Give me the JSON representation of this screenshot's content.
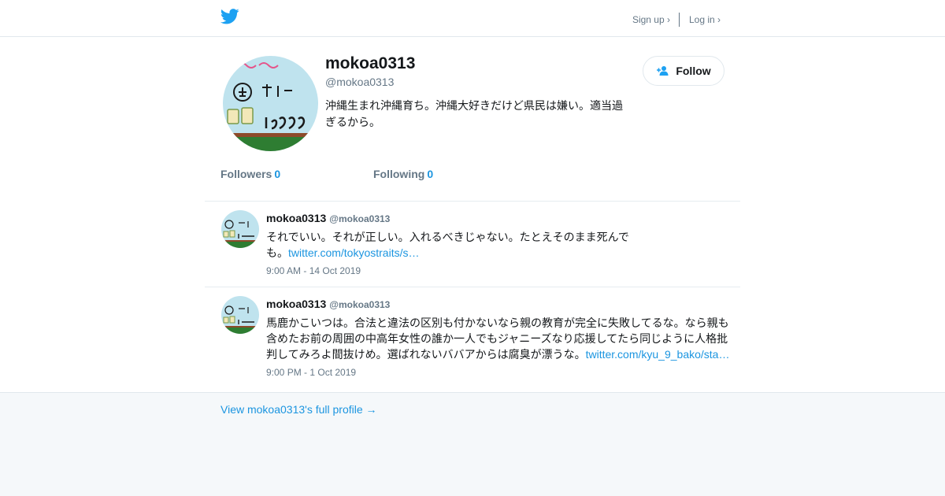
{
  "header": {
    "logo_icon": "twitter-bird-icon",
    "signup_label": "Sign up ›",
    "login_label": "Log in ›"
  },
  "profile": {
    "name": "mokoa0313",
    "handle": "@mokoa0313",
    "bio": "沖縄生まれ沖縄育ち。沖縄大好きだけど県民は嫌い。適当過ぎるから。",
    "follow_label": "Follow",
    "follow_icon": "add-person-icon",
    "followers_label": "Followers",
    "followers_count": "0",
    "following_label": "Following",
    "following_count": "0"
  },
  "tweets": [
    {
      "name": "mokoa0313",
      "handle": "@mokoa0313",
      "text": "それでいい。それが正しい。入れるべきじゃない。たとえそのまま死んでも。",
      "link": "twitter.com/tokyostraits/s…",
      "time": "9:00 AM - 14 Oct 2019"
    },
    {
      "name": "mokoa0313",
      "handle": "@mokoa0313",
      "text": "馬鹿かこいつは。合法と違法の区別も付かないなら親の教育が完全に失敗してるな。なら親も含めたお前の周囲の中高年女性の誰か一人でもジャニーズなり応援してたら同じように人格批判してみろよ間抜けめ。選ばれないババアからは腐臭が漂うな。",
      "link": "twitter.com/kyu_9_bako/sta…",
      "time": "9:00 PM - 1 Oct 2019"
    }
  ],
  "footer": {
    "full_profile_label": "View mokoa0313's full profile →"
  },
  "colors": {
    "accent": "#1b95e0",
    "logo": "#1da1f2",
    "muted": "#657786",
    "footer_bg": "#f5f8fa"
  }
}
